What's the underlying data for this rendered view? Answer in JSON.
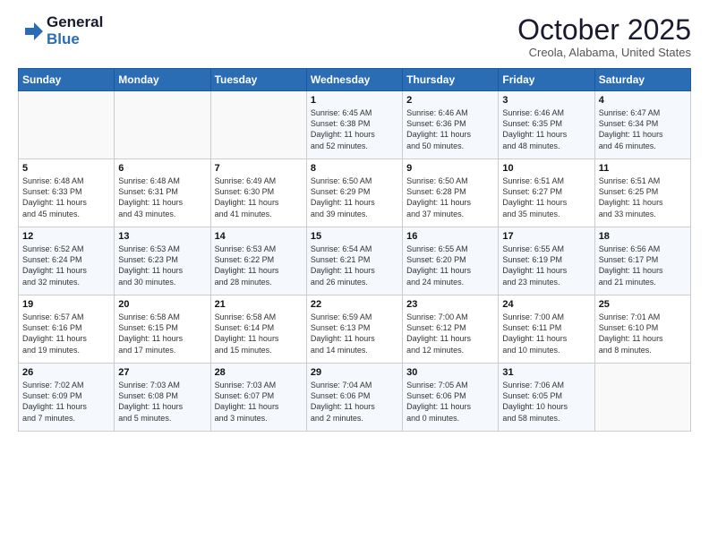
{
  "logo": {
    "general": "General",
    "blue": "Blue"
  },
  "title": "October 2025",
  "subtitle": "Creola, Alabama, United States",
  "headers": [
    "Sunday",
    "Monday",
    "Tuesday",
    "Wednesday",
    "Thursday",
    "Friday",
    "Saturday"
  ],
  "weeks": [
    [
      {
        "day": "",
        "info": ""
      },
      {
        "day": "",
        "info": ""
      },
      {
        "day": "",
        "info": ""
      },
      {
        "day": "1",
        "info": "Sunrise: 6:45 AM\nSunset: 6:38 PM\nDaylight: 11 hours\nand 52 minutes."
      },
      {
        "day": "2",
        "info": "Sunrise: 6:46 AM\nSunset: 6:36 PM\nDaylight: 11 hours\nand 50 minutes."
      },
      {
        "day": "3",
        "info": "Sunrise: 6:46 AM\nSunset: 6:35 PM\nDaylight: 11 hours\nand 48 minutes."
      },
      {
        "day": "4",
        "info": "Sunrise: 6:47 AM\nSunset: 6:34 PM\nDaylight: 11 hours\nand 46 minutes."
      }
    ],
    [
      {
        "day": "5",
        "info": "Sunrise: 6:48 AM\nSunset: 6:33 PM\nDaylight: 11 hours\nand 45 minutes."
      },
      {
        "day": "6",
        "info": "Sunrise: 6:48 AM\nSunset: 6:31 PM\nDaylight: 11 hours\nand 43 minutes."
      },
      {
        "day": "7",
        "info": "Sunrise: 6:49 AM\nSunset: 6:30 PM\nDaylight: 11 hours\nand 41 minutes."
      },
      {
        "day": "8",
        "info": "Sunrise: 6:50 AM\nSunset: 6:29 PM\nDaylight: 11 hours\nand 39 minutes."
      },
      {
        "day": "9",
        "info": "Sunrise: 6:50 AM\nSunset: 6:28 PM\nDaylight: 11 hours\nand 37 minutes."
      },
      {
        "day": "10",
        "info": "Sunrise: 6:51 AM\nSunset: 6:27 PM\nDaylight: 11 hours\nand 35 minutes."
      },
      {
        "day": "11",
        "info": "Sunrise: 6:51 AM\nSunset: 6:25 PM\nDaylight: 11 hours\nand 33 minutes."
      }
    ],
    [
      {
        "day": "12",
        "info": "Sunrise: 6:52 AM\nSunset: 6:24 PM\nDaylight: 11 hours\nand 32 minutes."
      },
      {
        "day": "13",
        "info": "Sunrise: 6:53 AM\nSunset: 6:23 PM\nDaylight: 11 hours\nand 30 minutes."
      },
      {
        "day": "14",
        "info": "Sunrise: 6:53 AM\nSunset: 6:22 PM\nDaylight: 11 hours\nand 28 minutes."
      },
      {
        "day": "15",
        "info": "Sunrise: 6:54 AM\nSunset: 6:21 PM\nDaylight: 11 hours\nand 26 minutes."
      },
      {
        "day": "16",
        "info": "Sunrise: 6:55 AM\nSunset: 6:20 PM\nDaylight: 11 hours\nand 24 minutes."
      },
      {
        "day": "17",
        "info": "Sunrise: 6:55 AM\nSunset: 6:19 PM\nDaylight: 11 hours\nand 23 minutes."
      },
      {
        "day": "18",
        "info": "Sunrise: 6:56 AM\nSunset: 6:17 PM\nDaylight: 11 hours\nand 21 minutes."
      }
    ],
    [
      {
        "day": "19",
        "info": "Sunrise: 6:57 AM\nSunset: 6:16 PM\nDaylight: 11 hours\nand 19 minutes."
      },
      {
        "day": "20",
        "info": "Sunrise: 6:58 AM\nSunset: 6:15 PM\nDaylight: 11 hours\nand 17 minutes."
      },
      {
        "day": "21",
        "info": "Sunrise: 6:58 AM\nSunset: 6:14 PM\nDaylight: 11 hours\nand 15 minutes."
      },
      {
        "day": "22",
        "info": "Sunrise: 6:59 AM\nSunset: 6:13 PM\nDaylight: 11 hours\nand 14 minutes."
      },
      {
        "day": "23",
        "info": "Sunrise: 7:00 AM\nSunset: 6:12 PM\nDaylight: 11 hours\nand 12 minutes."
      },
      {
        "day": "24",
        "info": "Sunrise: 7:00 AM\nSunset: 6:11 PM\nDaylight: 11 hours\nand 10 minutes."
      },
      {
        "day": "25",
        "info": "Sunrise: 7:01 AM\nSunset: 6:10 PM\nDaylight: 11 hours\nand 8 minutes."
      }
    ],
    [
      {
        "day": "26",
        "info": "Sunrise: 7:02 AM\nSunset: 6:09 PM\nDaylight: 11 hours\nand 7 minutes."
      },
      {
        "day": "27",
        "info": "Sunrise: 7:03 AM\nSunset: 6:08 PM\nDaylight: 11 hours\nand 5 minutes."
      },
      {
        "day": "28",
        "info": "Sunrise: 7:03 AM\nSunset: 6:07 PM\nDaylight: 11 hours\nand 3 minutes."
      },
      {
        "day": "29",
        "info": "Sunrise: 7:04 AM\nSunset: 6:06 PM\nDaylight: 11 hours\nand 2 minutes."
      },
      {
        "day": "30",
        "info": "Sunrise: 7:05 AM\nSunset: 6:06 PM\nDaylight: 11 hours\nand 0 minutes."
      },
      {
        "day": "31",
        "info": "Sunrise: 7:06 AM\nSunset: 6:05 PM\nDaylight: 10 hours\nand 58 minutes."
      },
      {
        "day": "",
        "info": ""
      }
    ]
  ]
}
